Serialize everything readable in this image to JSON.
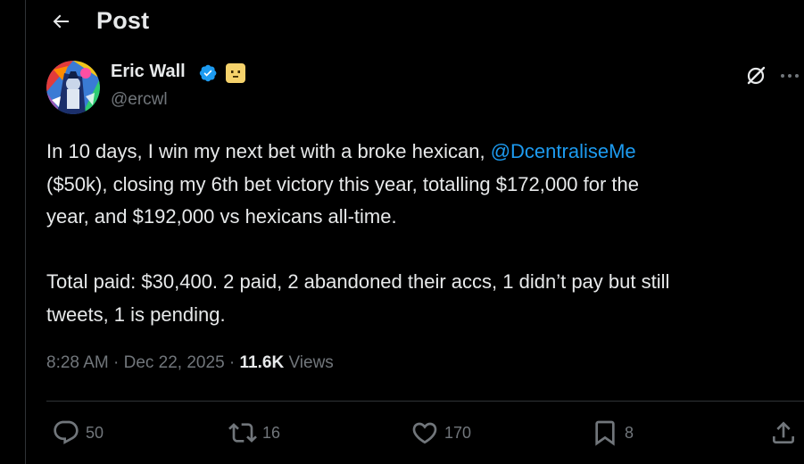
{
  "header": {
    "title": "Post"
  },
  "author": {
    "display_name": "Eric Wall",
    "handle": "@ercwl"
  },
  "tweet": {
    "line1_before": "In 10 days, I win my next bet with a broke hexican, ",
    "mention": "@DcentraliseMe",
    "line2": "($50k), closing my 6th bet victory this year, totalling $172,000 for the",
    "line3": "year, and $192,000 vs hexicans all-time.",
    "line4": "Total paid: $30,400. 2 paid, 2 abandoned their accs, 1 didn’t pay but still",
    "line5": "tweets, 1 is pending."
  },
  "meta": {
    "time": "8:28 AM",
    "separator": "·",
    "date": "Dec 22, 2025",
    "views_count": "11.6K",
    "views_label": "Views"
  },
  "actions": {
    "replies": "50",
    "reposts": "16",
    "likes": "170",
    "bookmarks": "8"
  },
  "colors": {
    "background": "#000000",
    "text": "#e7e9ea",
    "muted": "#71767b",
    "accent": "#1d9bf0",
    "verified": "#1d9bf0",
    "affiliate_badge": "#f5d26b"
  },
  "icons": {
    "back": "arrow-left-icon",
    "verified": "verified-badge-icon",
    "affiliate": "affiliate-badge-icon",
    "grok": "grok-icon",
    "more": "more-icon",
    "reply": "reply-icon",
    "repost": "repost-icon",
    "like": "heart-icon",
    "bookmark": "bookmark-icon",
    "share": "share-icon"
  }
}
